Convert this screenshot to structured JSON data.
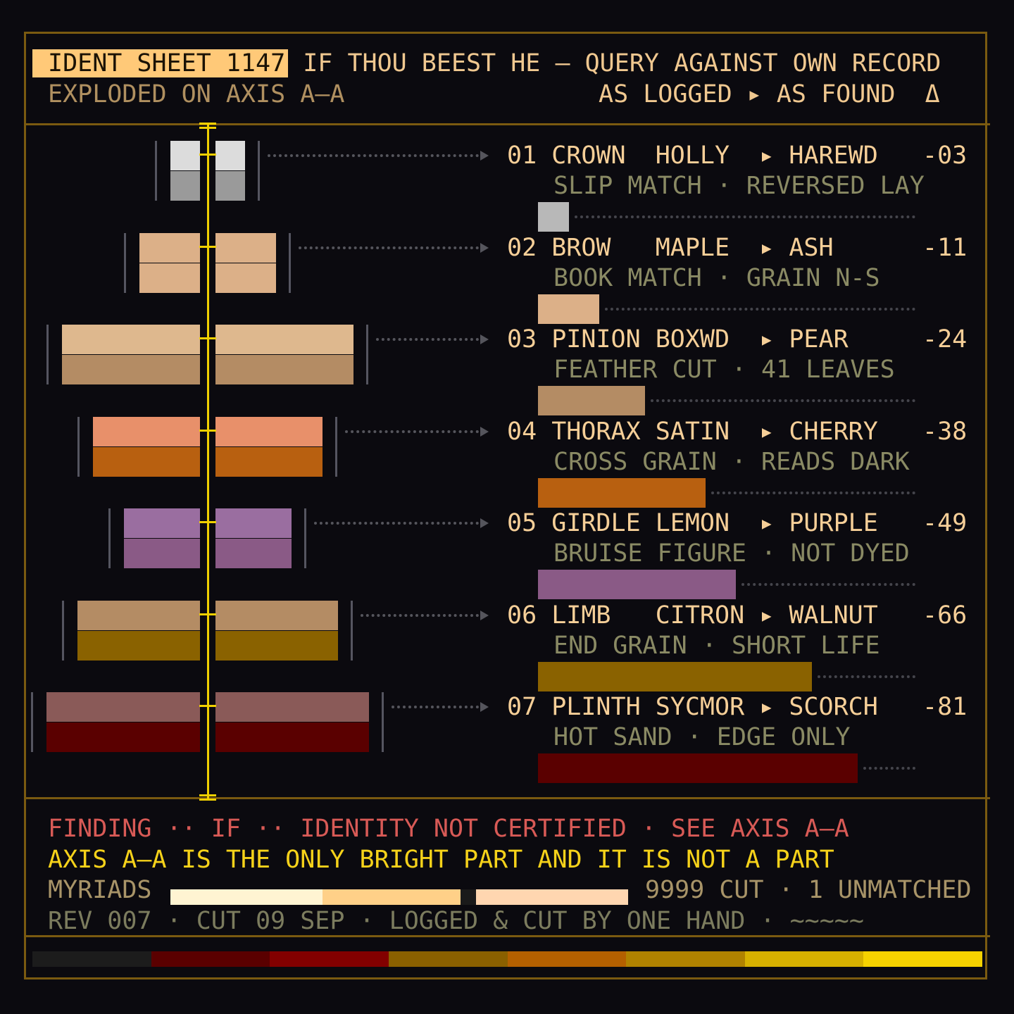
{
  "header": {
    "sheet_tag": "IDENT SHEET 1147",
    "title": "IF THOU BEEST HE — QUERY AGAINST OWN RECORD",
    "subtitle_left": "EXPLODED ON AXIS A—A",
    "subtitle_right": "AS LOGGED ▸ AS FOUND  Δ"
  },
  "rows": [
    {
      "line": "01 CROWN  HOLLY  ▸ HAREWD   -03",
      "note": "SLIP MATCH · REVERSED LAY",
      "swatch_color": "#b8b8b8",
      "swatch_fraction": 0.04,
      "top_color": "#dcdcdc",
      "bottom_color": "#9a9a9a"
    },
    {
      "line": "02 BROW   MAPLE  ▸ ASH      -11",
      "note": "BOOK MATCH · GRAIN N-S",
      "swatch_color": "#dcb088",
      "swatch_fraction": 0.12,
      "top_color": "#dcb088",
      "bottom_color": "#dcb088"
    },
    {
      "line": "03 PINION BOXWD  ▸ PEAR     -24",
      "note": "FEATHER CUT · 41 LEAVES",
      "swatch_color": "#b48c64",
      "swatch_fraction": 0.24,
      "top_color": "#deb88e",
      "bottom_color": "#b48c64"
    },
    {
      "line": "04 THORAX SATIN  ▸ CHERRY   -38",
      "note": "CROSS GRAIN · READS DARK",
      "swatch_color": "#b86010",
      "swatch_fraction": 0.4,
      "top_color": "#e8906a",
      "bottom_color": "#b86010"
    },
    {
      "line": "05 GIRDLE LEMON  ▸ PURPLE   -49",
      "note": "BRUISE FIGURE · NOT DYED",
      "swatch_color": "#8a5a86",
      "swatch_fraction": 0.48,
      "top_color": "#9a6ea0",
      "bottom_color": "#8a5a86"
    },
    {
      "line": "06 LIMB   CITRON ▸ WALNUT   -66",
      "note": "END GRAIN · SHORT LIFE",
      "swatch_color": "#8a6200",
      "swatch_fraction": 0.68,
      "top_color": "#b48c64",
      "bottom_color": "#8a6200"
    },
    {
      "line": "07 PLINTH SYCMOR ▸ SCORCH   -81",
      "note": "HOT SAND · EDGE ONLY",
      "swatch_color": "#5a0000",
      "swatch_fraction": 0.8,
      "top_color": "#8a5a58",
      "bottom_color": "#5a0000"
    }
  ],
  "footer": {
    "finding": "FINDING ·· IF ·· IDENTITY NOT CERTIFIED · SEE AXIS A—A",
    "axis_note": "AXIS A—A IS THE ONLY BRIGHT PART AND IT IS NOT A PART",
    "myriads_label": "MYRIADS",
    "myriads_summary": "9999 CUT · 1 UNMATCHED",
    "rev_line": "REV 007 · CUT 09 SEP · LOGGED & CUT BY ONE HAND · ~~~~~"
  },
  "gauge_colors": [
    "#fff4d2",
    "#ffd088",
    "#1a1a1a",
    "#ffd6b0"
  ],
  "ramp_colors": [
    "#1c1c1c",
    "#5a0000",
    "#820000",
    "#8a6000",
    "#b46000",
    "#b08200",
    "#d6b000",
    "#f6d200"
  ]
}
